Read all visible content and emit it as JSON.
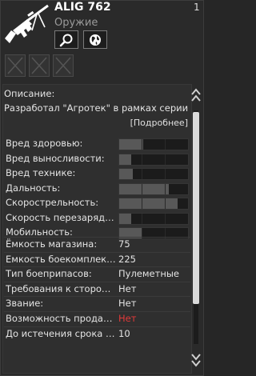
{
  "item": {
    "name": "ALIG 762",
    "type": "Оружие",
    "count": "1",
    "icon": "machine-gun-icon"
  },
  "buttons": {
    "inspect_icon": "magnifier-icon",
    "share_icon": "globe-icon"
  },
  "description": {
    "label": "Описание:",
    "text": "Разработал \"Агротек\" в рамках серии",
    "more": "[Подробнее]"
  },
  "bar_stats": [
    {
      "label": "Вред здоровью:",
      "level": 0.35
    },
    {
      "label": "Вред выносливости:",
      "level": 0.18
    },
    {
      "label": "Вред технике:",
      "level": 0.2
    },
    {
      "label": "Дальность:",
      "level": 0.72
    },
    {
      "label": "Скорострельность:",
      "level": 0.85
    },
    {
      "label": "Скорость перезарядки:",
      "level": 0.18
    },
    {
      "label": "Мобильность:",
      "level": 0.33
    }
  ],
  "text_stats": [
    {
      "label": "Ёмкость магазина:",
      "value": "75",
      "color": "#e4e4e4"
    },
    {
      "label": "Емкость боекомплекта:",
      "value": "225",
      "color": "#e4e4e4"
    },
    {
      "label": "Тип боеприпасов:",
      "value": "Пулеметные",
      "color": "#e4e4e4"
    },
    {
      "label": "Требования к стороне:",
      "value": "Нет",
      "color": "#e4e4e4"
    },
    {
      "label": "Звание:",
      "value": "Нет",
      "color": "#e4e4e4"
    },
    {
      "label": "Возможность продажи:",
      "value": "Нет",
      "color": "#e23a3a"
    },
    {
      "label": "До истечения срока д...",
      "value": "10",
      "color": "#e4e4e4"
    }
  ]
}
